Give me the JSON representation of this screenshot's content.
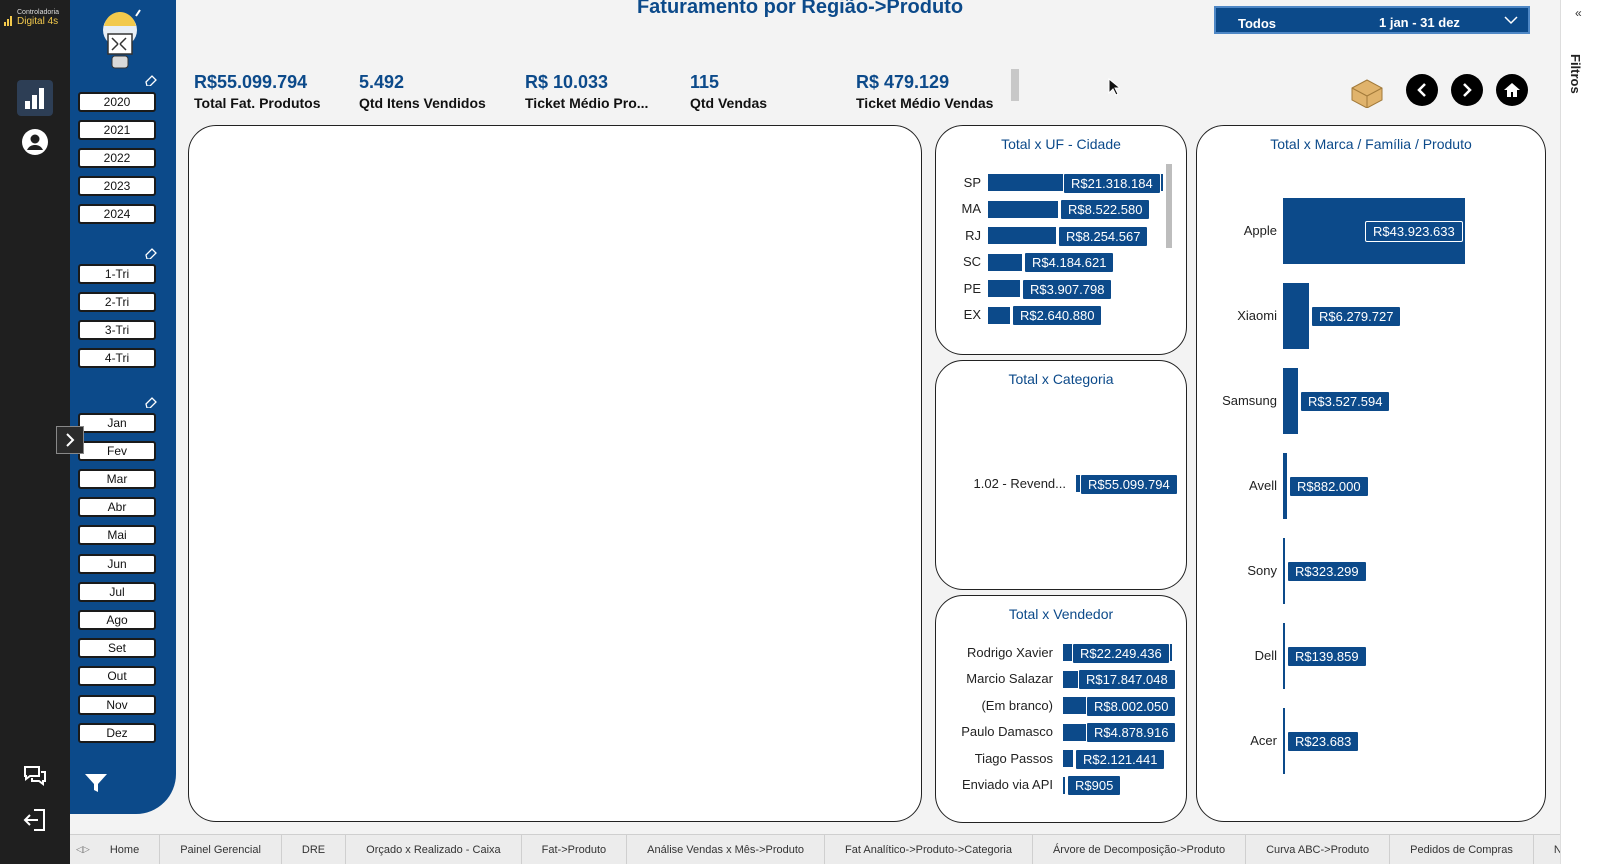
{
  "brand": {
    "line1": "Controladoria",
    "line2": "Digital 4s",
    "color": "#f2c94c"
  },
  "colors": {
    "primary": "#0c4a8a",
    "rail": "#1f1f1f",
    "background": "#f3f3f3"
  },
  "rail": {
    "icons": [
      "bar-chart-icon",
      "user-icon",
      "chat-icon",
      "exit-icon"
    ]
  },
  "filters": {
    "years": [
      "2020",
      "2021",
      "2022",
      "2023",
      "2024"
    ],
    "quarters": [
      "1-Tri",
      "2-Tri",
      "3-Tri",
      "4-Tri"
    ],
    "months": [
      "Jan",
      "Fev",
      "Mar",
      "Abr",
      "Mai",
      "Jun",
      "Jul",
      "Ago",
      "Set",
      "Out",
      "Nov",
      "Dez"
    ]
  },
  "header": {
    "title": "Faturamento por Região->Produto"
  },
  "period_slicer": {
    "selection": "Todos",
    "range": "1 jan - 31 dez"
  },
  "kpis": [
    {
      "value": "R$55.099.794",
      "label": "Total Fat. Produtos"
    },
    {
      "value": "5.492",
      "label": "Qtd Itens Vendidos"
    },
    {
      "value": "R$ 10.033",
      "label": "Ticket Médio Pro..."
    },
    {
      "value": "115",
      "label": "Qtd Vendas"
    },
    {
      "value": "R$ 479.129",
      "label": "Ticket Médio Vendas"
    }
  ],
  "nav": {
    "icons": [
      "box-icon",
      "back-arrow-icon",
      "forward-arrow-icon",
      "home-icon"
    ]
  },
  "chart_data": [
    {
      "type": "bar",
      "title": "Total x UF - Cidade",
      "categories": [
        "SP",
        "MA",
        "RJ",
        "SC",
        "PE",
        "EX"
      ],
      "values": [
        21318184,
        8522580,
        8254567,
        4184621,
        3907798,
        2640880
      ],
      "labels": [
        "R$21.318.184",
        "R$8.522.580",
        "R$8.254.567",
        "R$4.184.621",
        "R$3.907.798",
        "R$2.640.880"
      ]
    },
    {
      "type": "bar",
      "title": "Total x Categoria",
      "categories": [
        "1.02 - Revend..."
      ],
      "values": [
        55099794
      ],
      "labels": [
        "R$55.099.794"
      ]
    },
    {
      "type": "bar",
      "title": "Total x Vendedor",
      "categories": [
        "Rodrigo Xavier",
        "Marcio Salazar",
        "(Em branco)",
        "Paulo Damasco",
        "Tiago Passos",
        "Enviado via API"
      ],
      "values": [
        22249436,
        17847048,
        8002050,
        4878916,
        2121441,
        905
      ],
      "labels": [
        "R$22.249.436",
        "R$17.847.048",
        "R$8.002.050",
        "R$4.878.916",
        "R$2.121.441",
        "R$905"
      ]
    },
    {
      "type": "bar",
      "title": "Total x Marca / Família / Produto",
      "categories": [
        "Apple",
        "Xiaomi",
        "Samsung",
        "Avell",
        "Sony",
        "Dell",
        "Acer"
      ],
      "values": [
        43923633,
        6279727,
        3527594,
        882000,
        323299,
        139859,
        23683
      ],
      "labels": [
        "R$43.923.633",
        "R$6.279.727",
        "R$3.527.594",
        "R$882.000",
        "R$323.299",
        "R$139.859",
        "R$23.683"
      ]
    }
  ],
  "right_pane": {
    "label": "Filtros",
    "chevron": "«"
  },
  "tabs": [
    "Home",
    "Painel Gerencial",
    "DRE",
    "Orçado x Realizado - Caixa",
    "Fat->Produto",
    "Análise Vendas x Mês->Produto",
    "Fat Analítico->Produto->Categoria",
    "Árvore de Decomposição->Produto",
    "Curva ABC->Produto",
    "Pedidos de Compras",
    "Not"
  ]
}
